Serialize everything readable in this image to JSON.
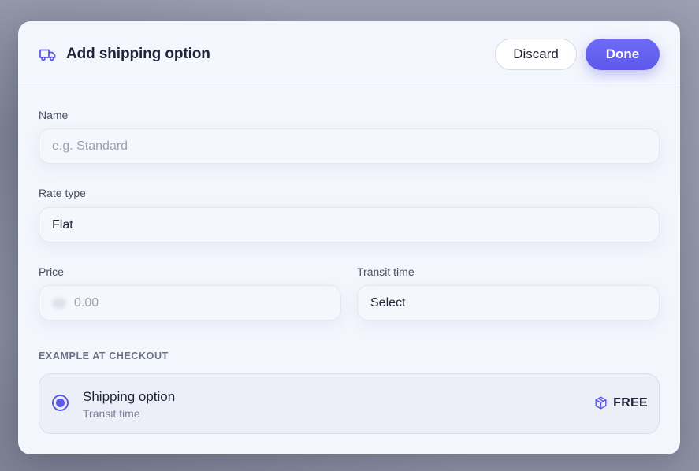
{
  "modal": {
    "title": "Add shipping option",
    "icon": "truck-icon",
    "discard_label": "Discard",
    "done_label": "Done",
    "accent_color": "#5d58ea"
  },
  "form": {
    "name": {
      "label": "Name",
      "placeholder": "e.g. Standard",
      "value": ""
    },
    "rate_type": {
      "label": "Rate type",
      "value": "Flat"
    },
    "price": {
      "label": "Price",
      "placeholder": "0.00",
      "value": ""
    },
    "transit_time": {
      "label": "Transit time",
      "value": "Select"
    }
  },
  "example": {
    "section_title": "EXAMPLE AT CHECKOUT",
    "option_title": "Shipping option",
    "option_subtitle": "Transit time",
    "price_label": "FREE",
    "price_icon": "box-icon",
    "selected": true
  }
}
